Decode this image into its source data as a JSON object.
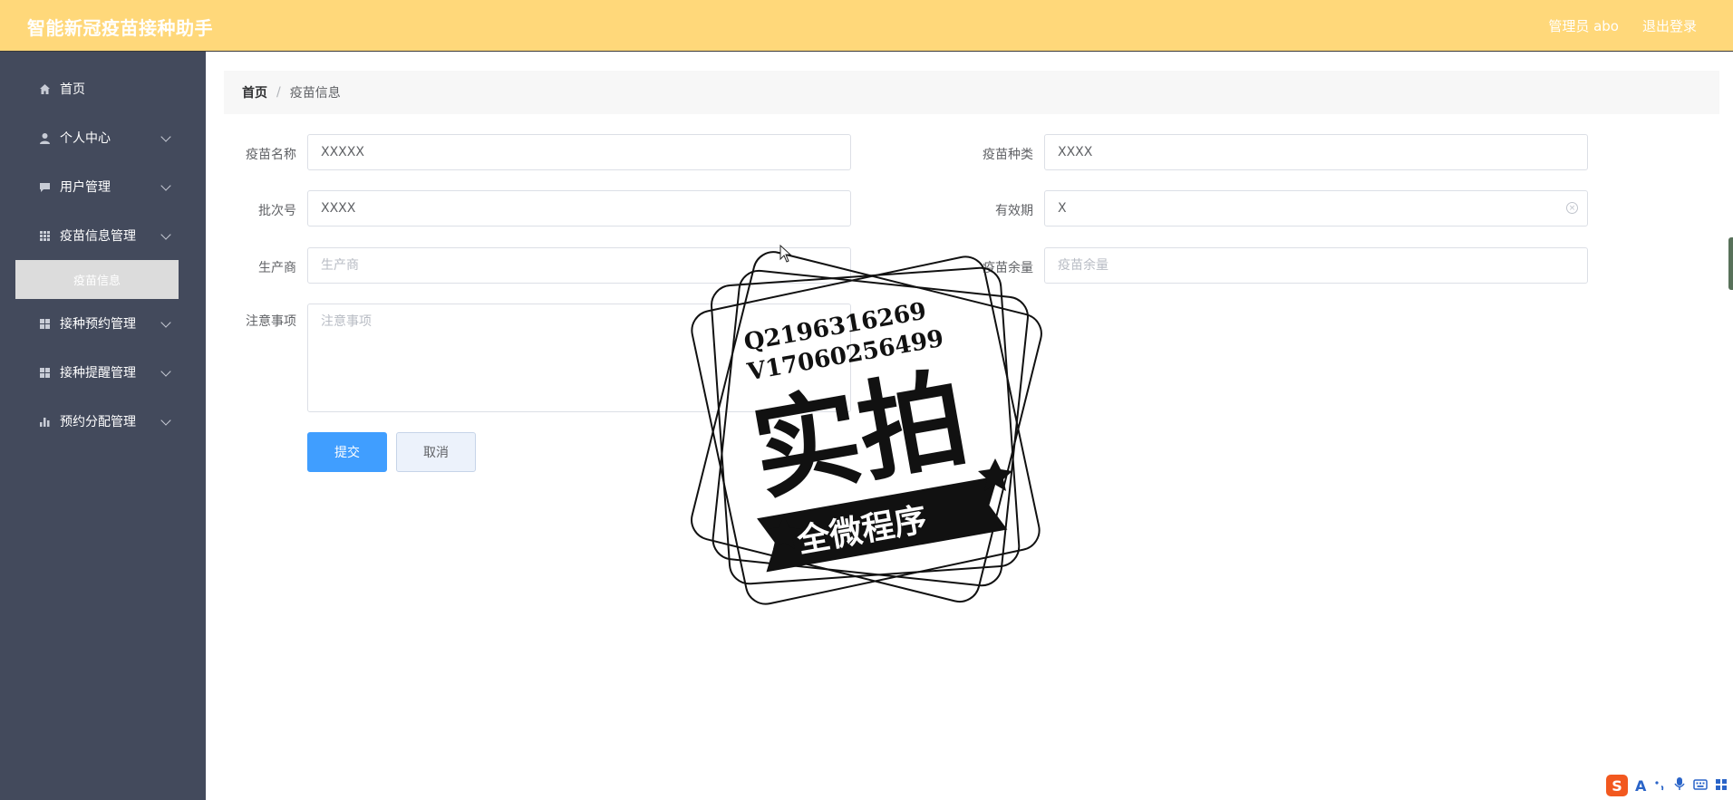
{
  "header": {
    "title": "智能新冠疫苗接种助手",
    "user_label": "管理员 abo",
    "logout_label": "退出登录"
  },
  "sidebar": {
    "items": [
      {
        "label": "首页",
        "icon": "home-icon"
      },
      {
        "label": "个人中心",
        "icon": "user-icon"
      },
      {
        "label": "用户管理",
        "icon": "chat-icon"
      },
      {
        "label": "疫苗信息管理",
        "icon": "grid-icon"
      },
      {
        "label": "接种预约管理",
        "icon": "apps-icon"
      },
      {
        "label": "接种提醒管理",
        "icon": "apps-icon"
      },
      {
        "label": "预约分配管理",
        "icon": "chart-icon"
      }
    ],
    "active_subitem": "疫苗信息"
  },
  "breadcrumb": {
    "home": "首页",
    "separator": "/",
    "current": "疫苗信息"
  },
  "form": {
    "vaccine_name": {
      "label": "疫苗名称",
      "value": "XXXXX"
    },
    "vaccine_type": {
      "label": "疫苗种类",
      "value": "XXXX"
    },
    "batch_no": {
      "label": "批次号",
      "value": "XXXX"
    },
    "expiry": {
      "label": "有效期",
      "value": "X"
    },
    "manufacturer": {
      "label": "生产商",
      "placeholder": "生产商"
    },
    "stock": {
      "label": "疫苗余量",
      "placeholder": "疫苗余量"
    },
    "notes": {
      "label": "注意事项",
      "placeholder": "注意事项"
    },
    "submit_label": "提交",
    "cancel_label": "取消"
  },
  "watermark": {
    "line1": "Q2196316269",
    "line2": "V17060256499",
    "main": "实拍",
    "banner": "全微程序"
  },
  "ime": {
    "logo": "S",
    "mode": "A"
  },
  "colors": {
    "header_bg": "#ffd87a",
    "sidebar_bg": "#434a5c",
    "primary": "#409eff"
  }
}
